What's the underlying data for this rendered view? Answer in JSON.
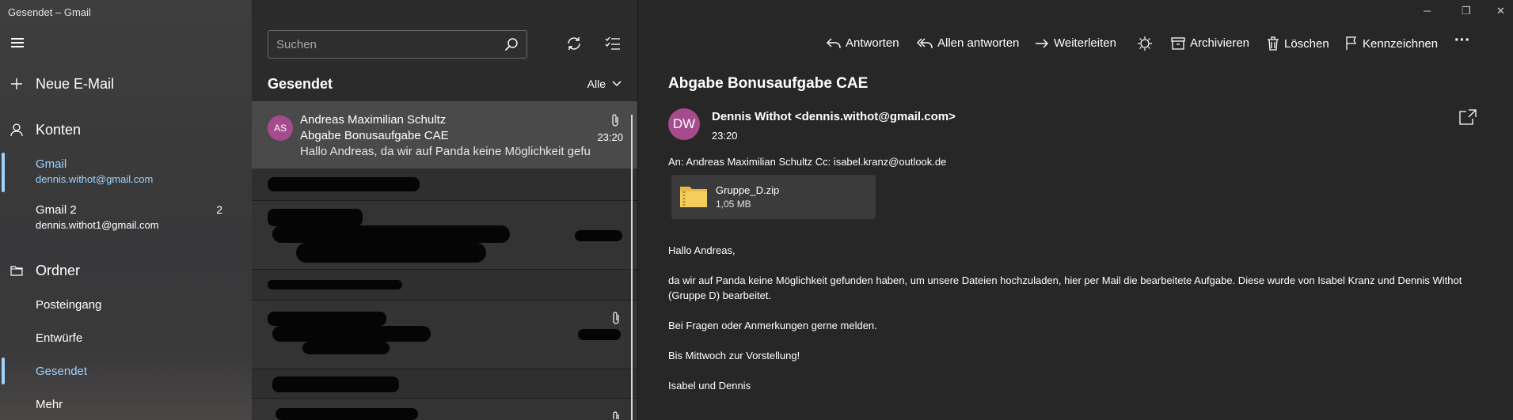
{
  "app": {
    "title": "Gesendet – Gmail"
  },
  "nav": {
    "new_mail": "Neue E-Mail",
    "accounts_heading": "Konten",
    "accounts": [
      {
        "name": "Gmail",
        "email": "dennis.withot@gmail.com",
        "count": ""
      },
      {
        "name": "Gmail 2",
        "email": "dennis.withot1@gmail.com",
        "count": "2"
      }
    ],
    "folders_heading": "Ordner",
    "folders": [
      "Posteingang",
      "Entwürfe",
      "Gesendet",
      "Mehr"
    ]
  },
  "list": {
    "search_placeholder": "Suchen",
    "heading": "Gesendet",
    "filter": "Alle",
    "selected_message": {
      "avatar": "AS",
      "from": "Andreas Maximilian Schultz",
      "subject": "Abgabe Bonusaufgabe CAE",
      "preview": "Hallo Andreas, da wir auf Panda keine Möglichkeit gefunden haben",
      "time": "23:20"
    }
  },
  "toolbar": {
    "reply": "Antworten",
    "reply_all": "Allen antworten",
    "forward": "Weiterleiten",
    "archive": "Archivieren",
    "delete": "Löschen",
    "flag": "Kennzeichnen",
    "more": "···"
  },
  "message": {
    "subject": "Abgabe Bonusaufgabe CAE",
    "avatar": "DW",
    "sender": "Dennis Withot <dennis.withot@gmail.com>",
    "time": "23:20",
    "recipients": "An: Andreas Maximilian Schultz Cc: isabel.kranz@outlook.de",
    "attachment": {
      "name": "Gruppe_D.zip",
      "size": "1,05 MB"
    },
    "body": [
      "Hallo Andreas,",
      "da wir auf Panda keine Möglichkeit gefunden haben, um unsere Dateien hochzuladen, hier per Mail die bearbeitete Aufgabe. Diese wurde von Isabel Kranz und Dennis Withot (Gruppe D) bearbeitet.",
      "Bei Fragen oder Anmerkungen gerne melden.",
      "Bis Mittwoch zur Vorstellung!",
      "Isabel und Dennis"
    ]
  },
  "colors": {
    "accent": "#9fd3ff",
    "avatar": "#a64c8e",
    "background": "#272727"
  }
}
